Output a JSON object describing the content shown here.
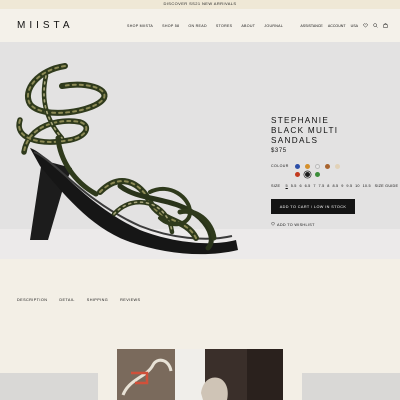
{
  "announcement": "DISCOVER SS21 NEW ARRIVALS",
  "logo": "MIISTA",
  "nav": [
    "SHOP MIISTA",
    "SHOP 58",
    "ON READ",
    "STORES",
    "ABOUT",
    "JOURNAL"
  ],
  "utility": {
    "assistance": "ASSISTANCE",
    "account": "ACCOUNT",
    "region": "USA",
    "icons": [
      "heart-icon",
      "search-icon",
      "bag-icon"
    ]
  },
  "product": {
    "title_line1": "STEPHANIE",
    "title_line2": "BLACK MULTI",
    "title_line3": "SANDALS",
    "price": "$375",
    "colour_label": "COLOUR",
    "colours": [
      "#2d4fa8",
      "#d5902c",
      "#e8e8e8",
      "#a8642e",
      "#e2d2b8",
      "#1d1d1d",
      "#c33a1f",
      "#3c8d3a"
    ],
    "size_label": "SIZE",
    "sizes": [
      "5",
      "5.5",
      "6",
      "6.5",
      "7",
      "7.5",
      "8",
      "8.5",
      "9",
      "9.5",
      "10",
      "10.5"
    ],
    "selected_size": "5",
    "size_guide": "SIZE GUIDE",
    "cart_button": "ADD TO CART / LOW IN STOCK",
    "wishlist": "ADD TO WISHLIST"
  },
  "tabs": [
    "DESCRIPTION",
    "DETAIL",
    "SHIPPING",
    "REVIEWS"
  ]
}
